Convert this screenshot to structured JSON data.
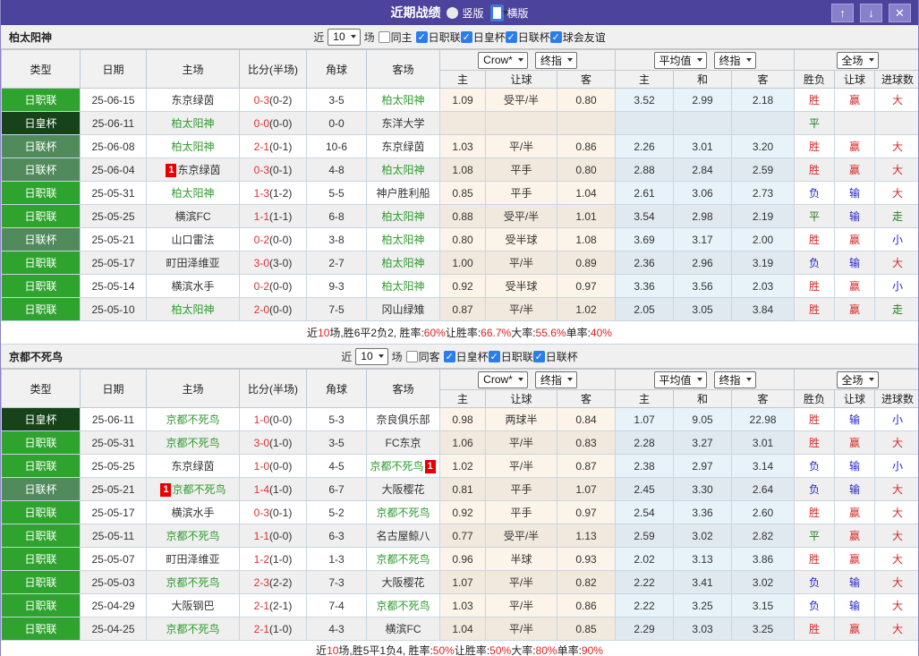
{
  "titlebar": {
    "title": "近期战绩",
    "radios": [
      {
        "label": "竖版",
        "selected": false
      },
      {
        "label": "横版",
        "selected": true
      }
    ],
    "buttons": {
      "up": "↑",
      "down": "↓",
      "close": "✕"
    },
    "bar_color": "#4c439c"
  },
  "colors": {
    "league_jleague": "#2ea32e",
    "league_emperor_cup": "#17431b",
    "league_league_cup": "#518b5c",
    "win_red": "#d42a2a",
    "lose_blue": "#2525cc",
    "draw_green": "#237d23",
    "focus_team_green": "#2e9b2e"
  },
  "tables": [
    {
      "team": "柏太阳神",
      "filter": {
        "near": "近",
        "count": "10",
        "games": "场",
        "same": "同主",
        "same_checked": false,
        "leagues": [
          "日职联",
          "日皇杯",
          "日联杯",
          "球会友谊"
        ]
      },
      "columns": [
        "类型",
        "日期",
        "主场",
        "比分(半场)",
        "角球",
        "客场"
      ],
      "odds_selects": {
        "g1": [
          "Crow*",
          "终指"
        ],
        "g2": [
          "平均值",
          "终指"
        ],
        "g3": [
          "全场"
        ]
      },
      "subcols": [
        "主",
        "让球",
        "客",
        "主",
        "和",
        "客",
        "胜负",
        "让球",
        "进球数"
      ],
      "rows": [
        {
          "league": "日职联",
          "lc": "a",
          "date": "25-06-15",
          "home": "东京绿茵",
          "hg": 0,
          "hb": "",
          "score": "0-3",
          "half": "(0-2)",
          "corner": "3-5",
          "away": "柏太阳神",
          "ag": 1,
          "ab": "",
          "odds": [
            "1.09",
            "受平/半",
            "0.80",
            "3.52",
            "2.99",
            "2.18"
          ],
          "res": [
            [
              "胜",
              "r"
            ],
            [
              "赢",
              "r"
            ],
            [
              "大",
              "r"
            ]
          ]
        },
        {
          "league": "日皇杯",
          "lc": "b",
          "date": "25-06-11",
          "home": "柏太阳神",
          "hg": 1,
          "hb": "",
          "score": "0-0",
          "half": "(0-0)",
          "corner": "0-0",
          "away": "东洋大学",
          "ag": 0,
          "ab": "",
          "odds": [
            "",
            "",
            "",
            "",
            "",
            ""
          ],
          "res": [
            [
              "平",
              "g"
            ],
            [
              "",
              ""
            ],
            [
              "",
              ""
            ]
          ]
        },
        {
          "league": "日联杯",
          "lc": "c",
          "date": "25-06-08",
          "home": "柏太阳神",
          "hg": 1,
          "hb": "",
          "score": "2-1",
          "half": "(0-1)",
          "corner": "10-6",
          "away": "东京绿茵",
          "ag": 0,
          "ab": "",
          "odds": [
            "1.03",
            "平/半",
            "0.86",
            "2.26",
            "3.01",
            "3.20"
          ],
          "res": [
            [
              "胜",
              "r"
            ],
            [
              "赢",
              "r"
            ],
            [
              "大",
              "r"
            ]
          ]
        },
        {
          "league": "日联杯",
          "lc": "c",
          "date": "25-06-04",
          "home": "东京绿茵",
          "hg": 0,
          "hb": "1",
          "score": "0-3",
          "half": "(0-1)",
          "corner": "4-8",
          "away": "柏太阳神",
          "ag": 1,
          "ab": "",
          "odds": [
            "1.08",
            "平手",
            "0.80",
            "2.88",
            "2.84",
            "2.59"
          ],
          "res": [
            [
              "胜",
              "r"
            ],
            [
              "赢",
              "r"
            ],
            [
              "大",
              "r"
            ]
          ]
        },
        {
          "league": "日职联",
          "lc": "a",
          "date": "25-05-31",
          "home": "柏太阳神",
          "hg": 1,
          "hb": "",
          "score": "1-3",
          "half": "(1-2)",
          "corner": "5-5",
          "away": "神户胜利船",
          "ag": 0,
          "ab": "",
          "odds": [
            "0.85",
            "平手",
            "1.04",
            "2.61",
            "3.06",
            "2.73"
          ],
          "res": [
            [
              "负",
              "b"
            ],
            [
              "输",
              "b"
            ],
            [
              "大",
              "r"
            ]
          ]
        },
        {
          "league": "日职联",
          "lc": "a",
          "date": "25-05-25",
          "home": "横滨FC",
          "hg": 0,
          "hb": "",
          "score": "1-1",
          "half": "(1-1)",
          "corner": "6-8",
          "away": "柏太阳神",
          "ag": 1,
          "ab": "",
          "odds": [
            "0.88",
            "受平/半",
            "1.01",
            "3.54",
            "2.98",
            "2.19"
          ],
          "res": [
            [
              "平",
              "g"
            ],
            [
              "输",
              "b"
            ],
            [
              "走",
              "g"
            ]
          ]
        },
        {
          "league": "日联杯",
          "lc": "c",
          "date": "25-05-21",
          "home": "山口雷法",
          "hg": 0,
          "hb": "",
          "score": "0-2",
          "half": "(0-0)",
          "corner": "3-8",
          "away": "柏太阳神",
          "ag": 1,
          "ab": "",
          "odds": [
            "0.80",
            "受半球",
            "1.08",
            "3.69",
            "3.17",
            "2.00"
          ],
          "res": [
            [
              "胜",
              "r"
            ],
            [
              "赢",
              "r"
            ],
            [
              "小",
              "b"
            ]
          ]
        },
        {
          "league": "日职联",
          "lc": "a",
          "date": "25-05-17",
          "home": "町田泽维亚",
          "hg": 0,
          "hb": "",
          "score": "3-0",
          "half": "(3-0)",
          "corner": "2-7",
          "away": "柏太阳神",
          "ag": 1,
          "ab": "",
          "odds": [
            "1.00",
            "平/半",
            "0.89",
            "2.36",
            "2.96",
            "3.19"
          ],
          "res": [
            [
              "负",
              "b"
            ],
            [
              "输",
              "b"
            ],
            [
              "大",
              "r"
            ]
          ]
        },
        {
          "league": "日职联",
          "lc": "a",
          "date": "25-05-14",
          "home": "横滨水手",
          "hg": 0,
          "hb": "",
          "score": "0-2",
          "half": "(0-0)",
          "corner": "9-3",
          "away": "柏太阳神",
          "ag": 1,
          "ab": "",
          "odds": [
            "0.92",
            "受半球",
            "0.97",
            "3.36",
            "3.56",
            "2.03"
          ],
          "res": [
            [
              "胜",
              "r"
            ],
            [
              "赢",
              "r"
            ],
            [
              "小",
              "b"
            ]
          ]
        },
        {
          "league": "日职联",
          "lc": "a",
          "date": "25-05-10",
          "home": "柏太阳神",
          "hg": 1,
          "hb": "",
          "score": "2-0",
          "half": "(0-0)",
          "corner": "7-5",
          "away": "冈山绿雉",
          "ag": 0,
          "ab": "",
          "odds": [
            "0.87",
            "平/半",
            "1.02",
            "2.05",
            "3.05",
            "3.84"
          ],
          "res": [
            [
              "胜",
              "r"
            ],
            [
              "赢",
              "r"
            ],
            [
              "走",
              "g"
            ]
          ]
        }
      ],
      "summary": [
        [
          "近",
          0
        ],
        [
          "10",
          1
        ],
        [
          "场,胜6平2负2, 胜率:",
          0
        ],
        [
          "60%",
          1
        ],
        [
          " 让胜率:",
          0
        ],
        [
          "66.7%",
          1
        ],
        [
          " 大率:",
          0
        ],
        [
          "55.6%",
          1
        ],
        [
          " 单率:",
          0
        ],
        [
          "40%",
          1
        ]
      ]
    },
    {
      "team": "京都不死鸟",
      "filter": {
        "near": "近",
        "count": "10",
        "games": "场",
        "same": "同客",
        "same_checked": false,
        "leagues": [
          "日皇杯",
          "日职联",
          "日联杯"
        ]
      },
      "columns": [
        "类型",
        "日期",
        "主场",
        "比分(半场)",
        "角球",
        "客场"
      ],
      "odds_selects": {
        "g1": [
          "Crow*",
          "终指"
        ],
        "g2": [
          "平均值",
          "终指"
        ],
        "g3": [
          "全场"
        ]
      },
      "subcols": [
        "主",
        "让球",
        "客",
        "主",
        "和",
        "客",
        "胜负",
        "让球",
        "进球数"
      ],
      "rows": [
        {
          "league": "日皇杯",
          "lc": "b",
          "date": "25-06-11",
          "home": "京都不死鸟",
          "hg": 1,
          "hb": "",
          "score": "1-0",
          "half": "(0-0)",
          "corner": "5-3",
          "away": "奈良俱乐部",
          "ag": 0,
          "ab": "",
          "odds": [
            "0.98",
            "两球半",
            "0.84",
            "1.07",
            "9.05",
            "22.98"
          ],
          "res": [
            [
              "胜",
              "r"
            ],
            [
              "输",
              "b"
            ],
            [
              "小",
              "b"
            ]
          ]
        },
        {
          "league": "日职联",
          "lc": "a",
          "date": "25-05-31",
          "home": "京都不死鸟",
          "hg": 1,
          "hb": "",
          "score": "3-0",
          "half": "(1-0)",
          "corner": "3-5",
          "away": "FC东京",
          "ag": 0,
          "ab": "",
          "odds": [
            "1.06",
            "平/半",
            "0.83",
            "2.28",
            "3.27",
            "3.01"
          ],
          "res": [
            [
              "胜",
              "r"
            ],
            [
              "赢",
              "r"
            ],
            [
              "大",
              "r"
            ]
          ]
        },
        {
          "league": "日职联",
          "lc": "a",
          "date": "25-05-25",
          "home": "东京绿茵",
          "hg": 0,
          "hb": "",
          "score": "1-0",
          "half": "(0-0)",
          "corner": "4-5",
          "away": "京都不死鸟",
          "ag": 1,
          "ab": "1",
          "odds": [
            "1.02",
            "平/半",
            "0.87",
            "2.38",
            "2.97",
            "3.14"
          ],
          "res": [
            [
              "负",
              "b"
            ],
            [
              "输",
              "b"
            ],
            [
              "小",
              "b"
            ]
          ]
        },
        {
          "league": "日联杯",
          "lc": "c",
          "date": "25-05-21",
          "home": "京都不死鸟",
          "hg": 1,
          "hb": "1",
          "score": "1-4",
          "half": "(1-0)",
          "corner": "6-7",
          "away": "大阪樱花",
          "ag": 0,
          "ab": "",
          "odds": [
            "0.81",
            "平手",
            "1.07",
            "2.45",
            "3.30",
            "2.64"
          ],
          "res": [
            [
              "负",
              "b"
            ],
            [
              "输",
              "b"
            ],
            [
              "大",
              "r"
            ]
          ]
        },
        {
          "league": "日职联",
          "lc": "a",
          "date": "25-05-17",
          "home": "横滨水手",
          "hg": 0,
          "hb": "",
          "score": "0-3",
          "half": "(0-1)",
          "corner": "5-2",
          "away": "京都不死鸟",
          "ag": 1,
          "ab": "",
          "odds": [
            "0.92",
            "平手",
            "0.97",
            "2.54",
            "3.36",
            "2.60"
          ],
          "res": [
            [
              "胜",
              "r"
            ],
            [
              "赢",
              "r"
            ],
            [
              "大",
              "r"
            ]
          ]
        },
        {
          "league": "日职联",
          "lc": "a",
          "date": "25-05-11",
          "home": "京都不死鸟",
          "hg": 1,
          "hb": "",
          "score": "1-1",
          "half": "(0-0)",
          "corner": "6-3",
          "away": "名古屋鲸八",
          "ag": 0,
          "ab": "",
          "odds": [
            "0.77",
            "受平/半",
            "1.13",
            "2.59",
            "3.02",
            "2.82"
          ],
          "res": [
            [
              "平",
              "g"
            ],
            [
              "赢",
              "r"
            ],
            [
              "大",
              "r"
            ]
          ]
        },
        {
          "league": "日职联",
          "lc": "a",
          "date": "25-05-07",
          "home": "町田泽维亚",
          "hg": 0,
          "hb": "",
          "score": "1-2",
          "half": "(1-0)",
          "corner": "1-3",
          "away": "京都不死鸟",
          "ag": 1,
          "ab": "",
          "odds": [
            "0.96",
            "半球",
            "0.93",
            "2.02",
            "3.13",
            "3.86"
          ],
          "res": [
            [
              "胜",
              "r"
            ],
            [
              "赢",
              "r"
            ],
            [
              "大",
              "r"
            ]
          ]
        },
        {
          "league": "日职联",
          "lc": "a",
          "date": "25-05-03",
          "home": "京都不死鸟",
          "hg": 1,
          "hb": "",
          "score": "2-3",
          "half": "(2-2)",
          "corner": "7-3",
          "away": "大阪樱花",
          "ag": 0,
          "ab": "",
          "odds": [
            "1.07",
            "平/半",
            "0.82",
            "2.22",
            "3.41",
            "3.02"
          ],
          "res": [
            [
              "负",
              "b"
            ],
            [
              "输",
              "b"
            ],
            [
              "大",
              "r"
            ]
          ]
        },
        {
          "league": "日职联",
          "lc": "a",
          "date": "25-04-29",
          "home": "大阪钢巴",
          "hg": 0,
          "hb": "",
          "score": "2-1",
          "half": "(2-1)",
          "corner": "7-4",
          "away": "京都不死鸟",
          "ag": 1,
          "ab": "",
          "odds": [
            "1.03",
            "平/半",
            "0.86",
            "2.22",
            "3.25",
            "3.15"
          ],
          "res": [
            [
              "负",
              "b"
            ],
            [
              "输",
              "b"
            ],
            [
              "大",
              "r"
            ]
          ]
        },
        {
          "league": "日职联",
          "lc": "a",
          "date": "25-04-25",
          "home": "京都不死鸟",
          "hg": 1,
          "hb": "",
          "score": "2-1",
          "half": "(1-0)",
          "corner": "4-3",
          "away": "横滨FC",
          "ag": 0,
          "ab": "",
          "odds": [
            "1.04",
            "平/半",
            "0.85",
            "2.29",
            "3.03",
            "3.25"
          ],
          "res": [
            [
              "胜",
              "r"
            ],
            [
              "赢",
              "r"
            ],
            [
              "大",
              "r"
            ]
          ]
        }
      ],
      "summary": [
        [
          "近",
          0
        ],
        [
          "10",
          1
        ],
        [
          "场,胜5平1负4, 胜率:",
          0
        ],
        [
          "50%",
          1
        ],
        [
          " 让胜率:",
          0
        ],
        [
          "50%",
          1
        ],
        [
          " 大率:",
          0
        ],
        [
          "80%",
          1
        ],
        [
          " 单率:",
          0
        ],
        [
          "90%",
          1
        ]
      ]
    }
  ]
}
